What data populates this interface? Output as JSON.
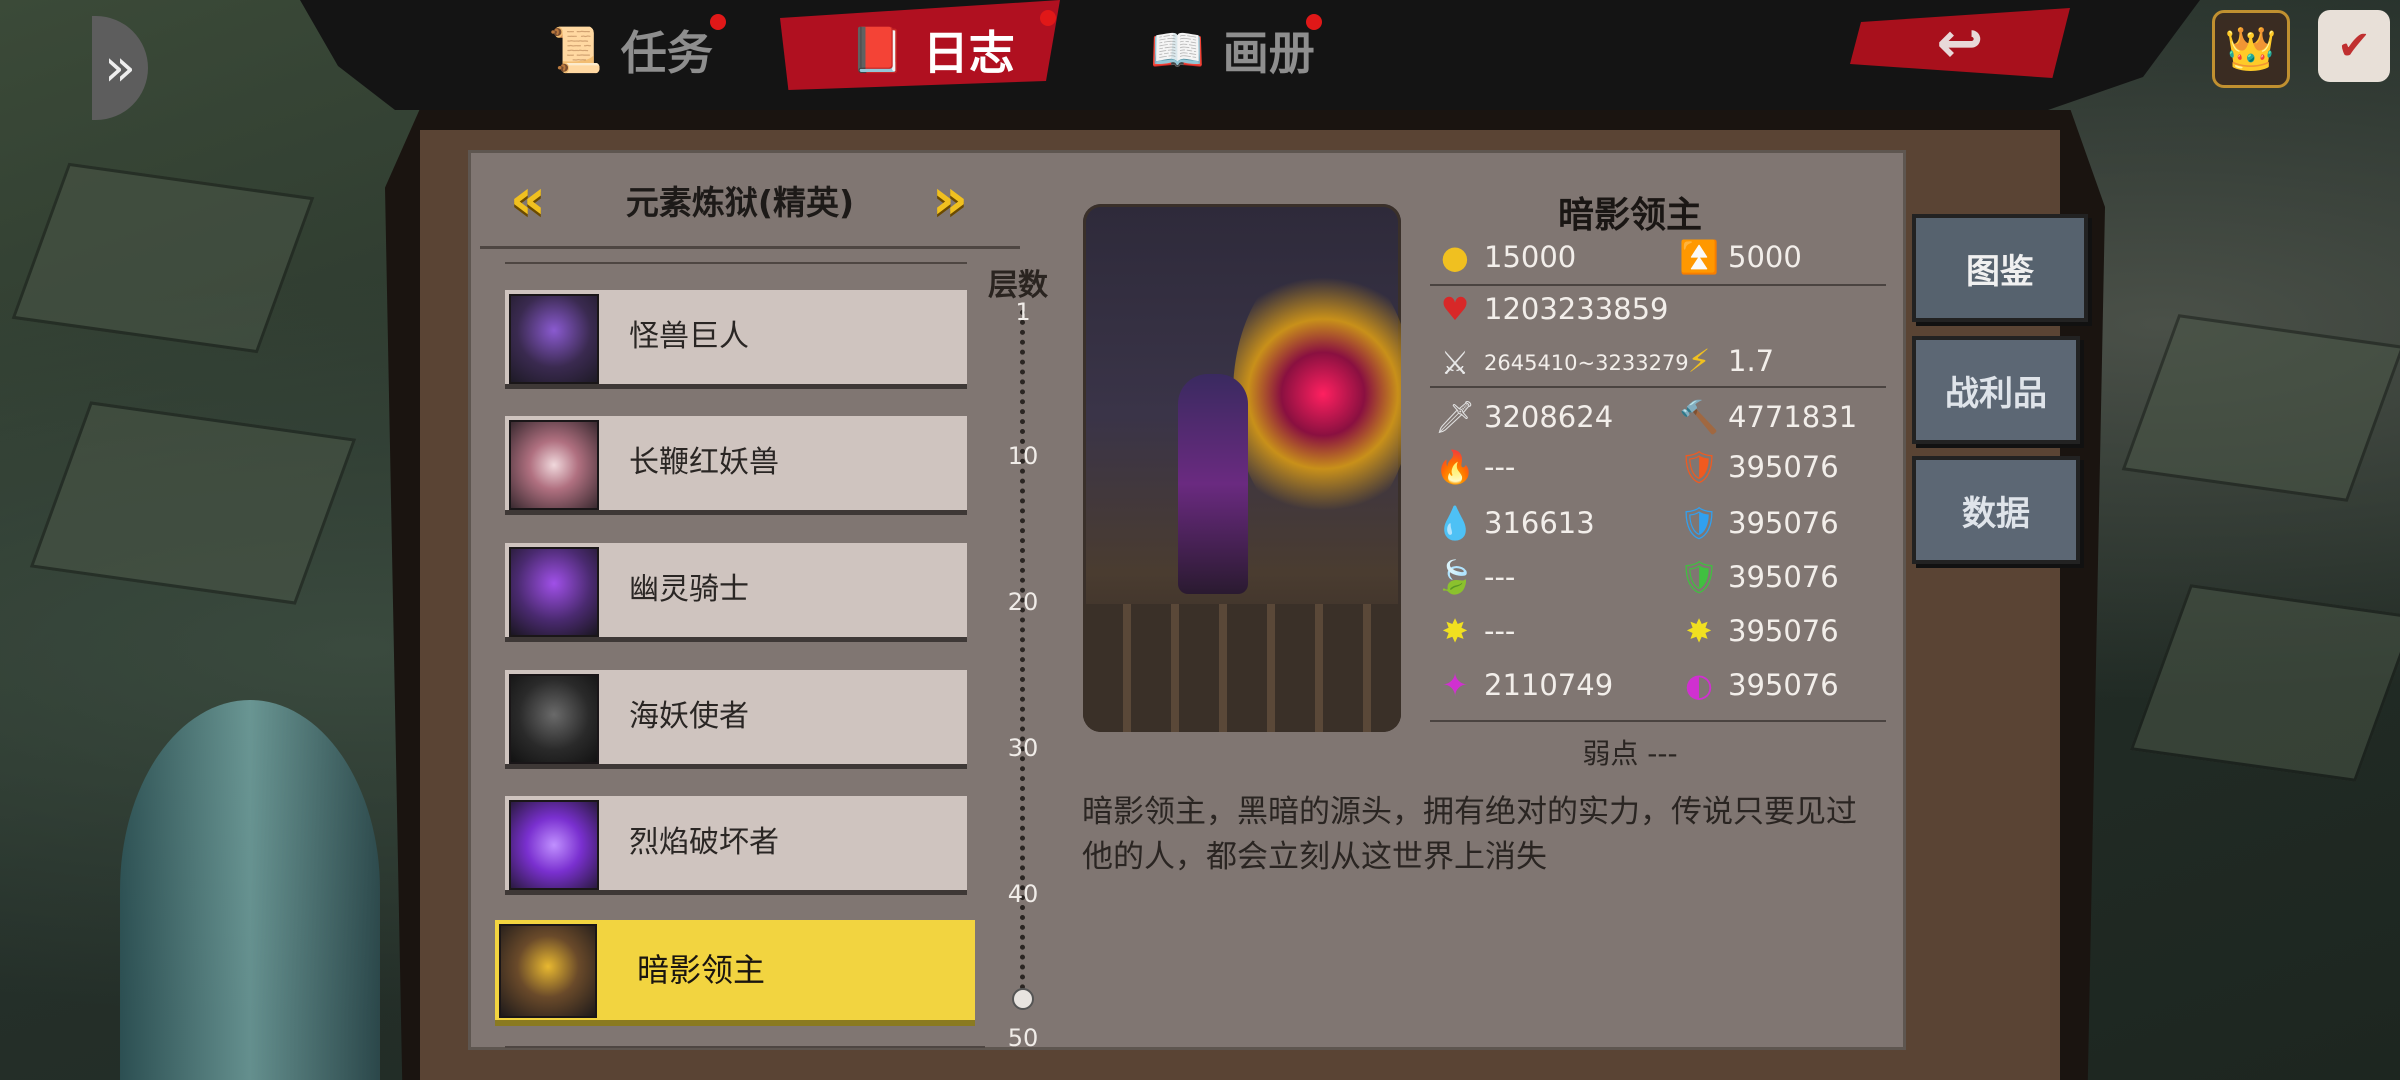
{
  "tabs": [
    {
      "label": "任务",
      "icon": "scroll-icon",
      "active": false
    },
    {
      "label": "日志",
      "icon": "journal-icon",
      "active": true
    },
    {
      "label": "画册",
      "icon": "book-icon",
      "active": false
    }
  ],
  "stage": {
    "title": "元素炼狱(精英)"
  },
  "monsters": [
    {
      "name": "怪兽巨人",
      "selected": false,
      "color": "#6a3fa8"
    },
    {
      "name": "长鞭红妖兽",
      "selected": false,
      "color": "#c8a8b0"
    },
    {
      "name": "幽灵骑士",
      "selected": false,
      "color": "#7a3fc0"
    },
    {
      "name": "海妖使者",
      "selected": false,
      "color": "#3a3a3a"
    },
    {
      "name": "烈焰破坏者",
      "selected": false,
      "color": "#8a3ae0"
    },
    {
      "name": "暗影领主",
      "selected": true,
      "color": "#d8a020"
    }
  ],
  "layers": {
    "title": "层数",
    "ticks": [
      "1",
      "10",
      "20",
      "30",
      "40",
      "50"
    ]
  },
  "boss": {
    "name": "暗影领主",
    "gold": "15000",
    "exp": "5000",
    "hp": "1203233859",
    "attack_range": "2645410~3233279",
    "attack_speed": "1.7",
    "physical_attack": "3208624",
    "physical_defense": "4771831",
    "fire_attack": "---",
    "fire_defense": "395076",
    "water_attack": "316613",
    "water_defense": "395076",
    "wood_attack": "---",
    "wood_defense": "395076",
    "light_attack": "---",
    "light_defense": "395076",
    "dark_attack": "2110749",
    "dark_defense": "395076",
    "weakness": "弱点 ---",
    "description": "暗影领主，黑暗的源头，拥有绝对的实力，传说只要见过他的人，都会立刻从这世界上消失"
  },
  "side_buttons": [
    {
      "label": "图鉴",
      "active": true
    },
    {
      "label": "战利品",
      "active": false
    },
    {
      "label": "数据",
      "active": false
    }
  ],
  "colors": {
    "accent_red": "#b01020",
    "highlight_yellow": "#f2d440",
    "panel": "#807672"
  }
}
